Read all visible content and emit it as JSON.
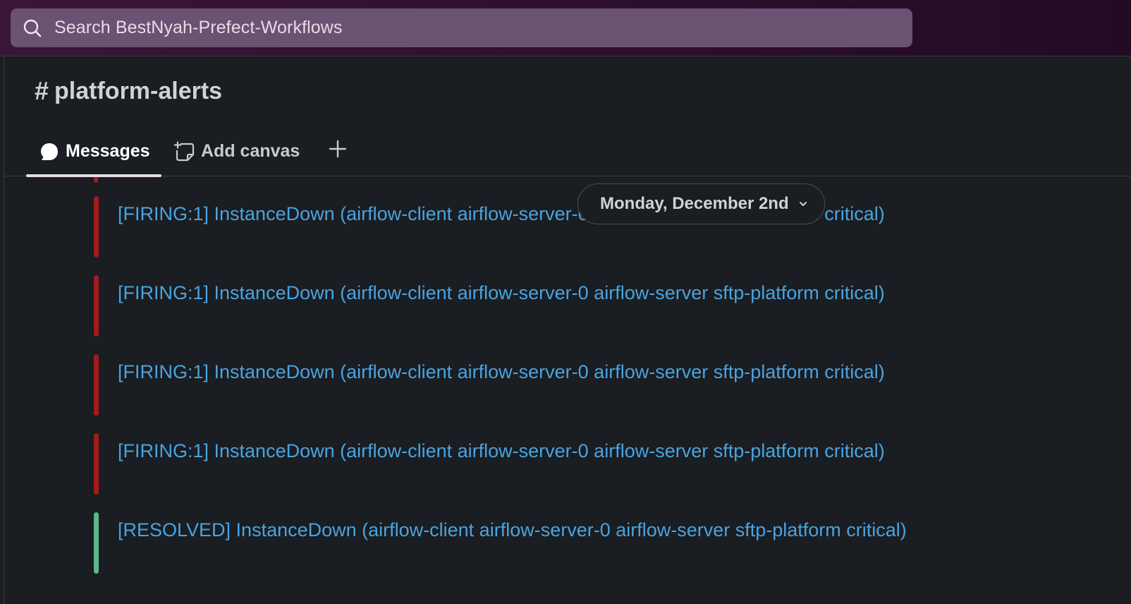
{
  "search": {
    "placeholder": "Search BestNyah-Prefect-Workflows"
  },
  "channel": {
    "hash": "#",
    "name": "platform-alerts"
  },
  "tabs": {
    "messages": "Messages",
    "add_canvas": "Add canvas"
  },
  "date_divider": {
    "label": "Monday, December 2nd"
  },
  "alerts": [
    {
      "status": "firing",
      "text": "[FIRING:1] InstanceDown (airflow-client airflow-server-0 airflow-server sftp-platform critical)"
    },
    {
      "status": "firing",
      "text": "[FIRING:1] InstanceDown (airflow-client airflow-server-0 airflow-server sftp-platform critical)"
    },
    {
      "status": "firing",
      "text": "[FIRING:1] InstanceDown (airflow-client airflow-server-0 airflow-server sftp-platform critical)"
    },
    {
      "status": "firing",
      "text": "[FIRING:1] InstanceDown (airflow-client airflow-server-0 airflow-server sftp-platform critical)"
    },
    {
      "status": "resolved",
      "text": "[RESOLVED] InstanceDown (airflow-client airflow-server-0 airflow-server sftp-platform critical)"
    }
  ],
  "colors": {
    "firing": "#a31b1b",
    "resolved": "#5cb78a",
    "link": "#4aa3e0",
    "top_bar": "#3b1538"
  }
}
